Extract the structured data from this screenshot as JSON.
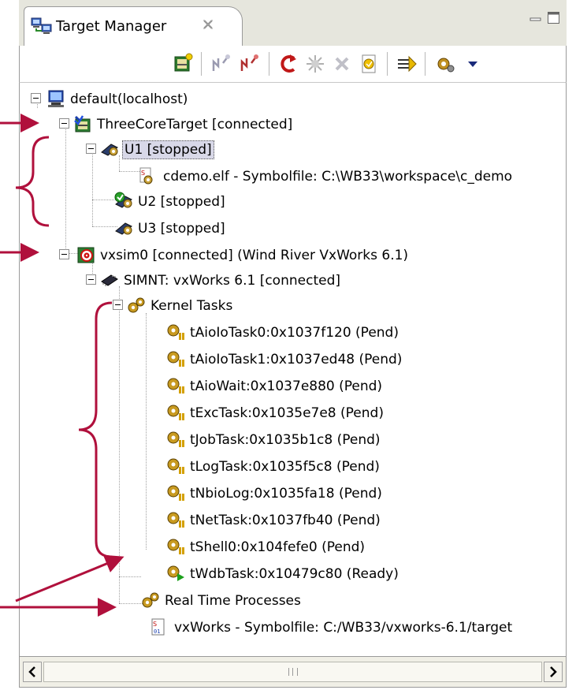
{
  "view": {
    "title": "Target Manager",
    "close_icon": "close-x-icon"
  },
  "toolbar": {
    "buttons": [
      "new-connection-icon",
      "connect-icon",
      "disconnect-icon",
      "reset-icon",
      "attach-icon",
      "remove-icon",
      "properties-icon",
      "target-mode-icon",
      "menu-icon"
    ]
  },
  "tree": {
    "root": "default(localhost)",
    "three_core": "ThreeCoreTarget [connected]",
    "u1": "U1 [stopped]",
    "u1_child": "cdemo.elf - Symbolfile: C:\\WB33\\workspace\\c_demo",
    "u2": "U2 [stopped]",
    "u3": "U3 [stopped]",
    "vxsim": "vxsim0 [connected] (Wind River VxWorks 6.1)",
    "simnt": "SIMNT: vxWorks 6.1 [connected]",
    "kernel_tasks": "Kernel Tasks",
    "tasks": [
      "tAioIoTask0:0x1037f120 (Pend)",
      "tAioIoTask1:0x1037ed48 (Pend)",
      "tAioWait:0x1037e880 (Pend)",
      "tExcTask:0x1035e7e8 (Pend)",
      "tJobTask:0x1035b1c8 (Pend)",
      "tLogTask:0x1035f5c8 (Pend)",
      "tNbioLog:0x1035fa18 (Pend)",
      "tNetTask:0x1037fb40 (Pend)",
      "tShell0:0x104fefe0 (Pend)",
      "tWdbTask:0x10479c80 (Ready)"
    ],
    "rtp": "Real Time Processes",
    "symbolfile": "vxWorks - Symbolfile: C:/WB33/vxworks-6.1/target"
  },
  "colors": {
    "annotation": "#b0103c",
    "selection": "#d8d8e8"
  }
}
